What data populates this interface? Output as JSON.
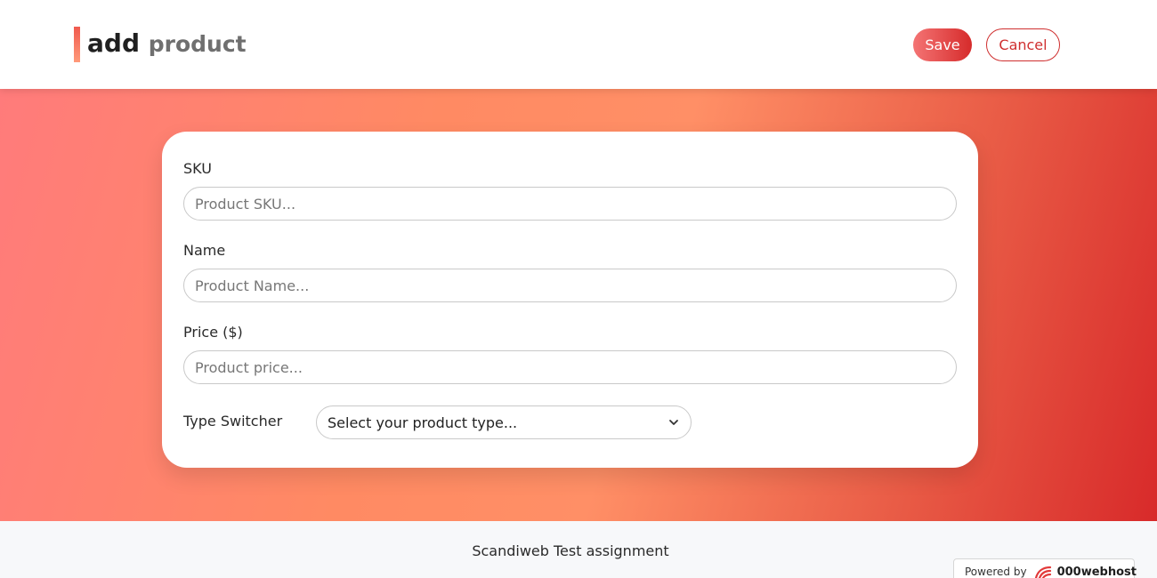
{
  "header": {
    "title_word1": "add",
    "title_word2": "product",
    "save_label": "Save",
    "cancel_label": "Cancel"
  },
  "form": {
    "sku": {
      "label": "SKU",
      "placeholder": "Product SKU...",
      "value": ""
    },
    "name": {
      "label": "Name",
      "placeholder": "Product Name...",
      "value": ""
    },
    "price": {
      "label": "Price ($)",
      "placeholder": "Product price...",
      "value": ""
    },
    "type_switcher": {
      "label": "Type Switcher",
      "selected": "Select your product type..."
    }
  },
  "footer": {
    "text": "Scandiweb Test assignment",
    "powered_by": "Powered by",
    "host_brand": "000webhost"
  },
  "icons": {
    "chevron": "chevron-down-icon",
    "host_logo": "000webhost-logo-icon"
  },
  "colors": {
    "accent": "#d62b2b",
    "gradient_light": "#ff8a63",
    "gradient_dark": "#d82a2a"
  }
}
